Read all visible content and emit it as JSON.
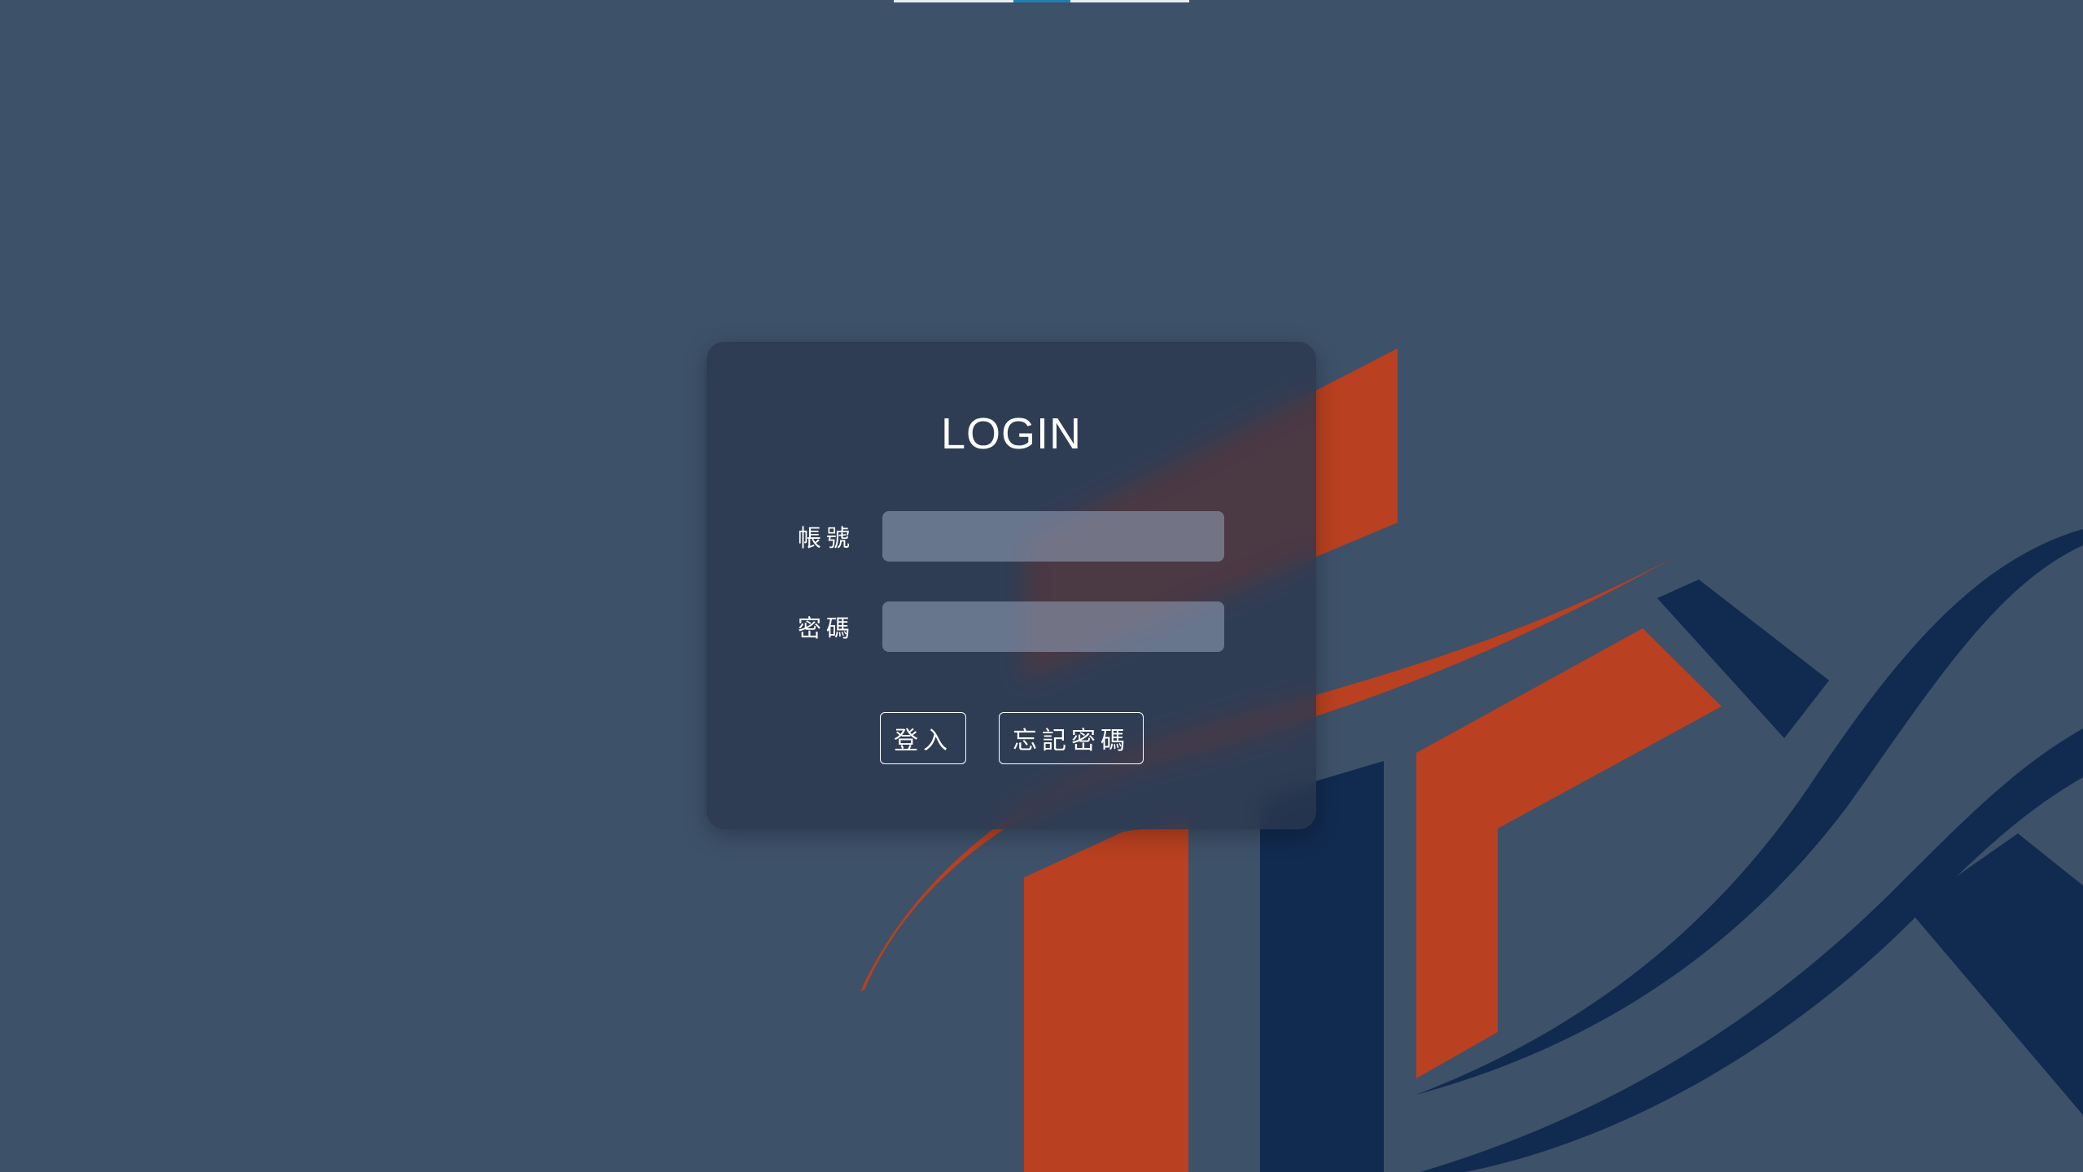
{
  "login": {
    "title": "LOGIN",
    "account_label": "帳號",
    "account_value": "",
    "password_label": "密碼",
    "password_value": "",
    "login_button": "登入",
    "forgot_button": "忘記密碼"
  },
  "colors": {
    "background": "#3d5169",
    "logo_orange": "#b94020",
    "logo_navy": "#112a4f",
    "card": "#2c374e"
  },
  "icons": {
    "logo": "company-logo-mark"
  }
}
